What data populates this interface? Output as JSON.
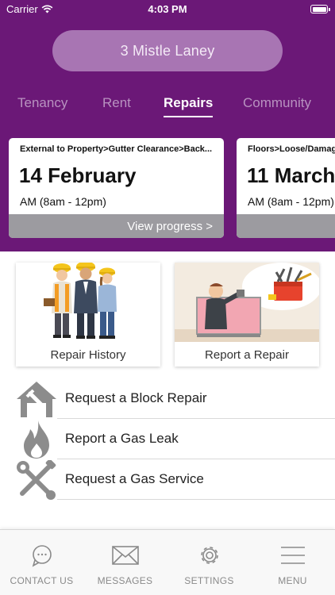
{
  "status_bar": {
    "carrier": "Carrier",
    "time": "4:03 PM"
  },
  "address": "3 Mistle Laney",
  "tabs": [
    {
      "label": "Tenancy",
      "active": false
    },
    {
      "label": "Rent",
      "active": false
    },
    {
      "label": "Repairs",
      "active": true
    },
    {
      "label": "Community",
      "active": false
    }
  ],
  "repair_cards": [
    {
      "category": "External to Property>Gutter Clearance>Back...",
      "date": "14 February",
      "time_slot": "AM (8am - 12pm)",
      "action": "View progress >"
    },
    {
      "category": "Floors>Loose/Damage",
      "date": "11 March",
      "time_slot": "AM (8am - 12pm)",
      "action": ""
    }
  ],
  "tiles": [
    {
      "label": "Repair History"
    },
    {
      "label": "Report a Repair"
    }
  ],
  "menu_items": [
    {
      "label": "Request a Block Repair",
      "icon": "house-repair-icon"
    },
    {
      "label": "Report a Gas Leak",
      "icon": "flame-icon"
    },
    {
      "label": "Request a Gas Service",
      "icon": "wrench-screwdriver-icon"
    }
  ],
  "tab_bar": [
    {
      "label": "CONTACT US",
      "icon": "chat-bubble-icon"
    },
    {
      "label": "MESSAGES",
      "icon": "envelope-icon"
    },
    {
      "label": "SETTINGS",
      "icon": "gear-icon"
    },
    {
      "label": "MENU",
      "icon": "hamburger-menu-icon"
    }
  ],
  "colors": {
    "brand_purple": "#6b1877",
    "pill_purple": "#a875b3",
    "card_footer_gray": "#9c9ba0",
    "icon_gray": "#8a8a8a"
  }
}
